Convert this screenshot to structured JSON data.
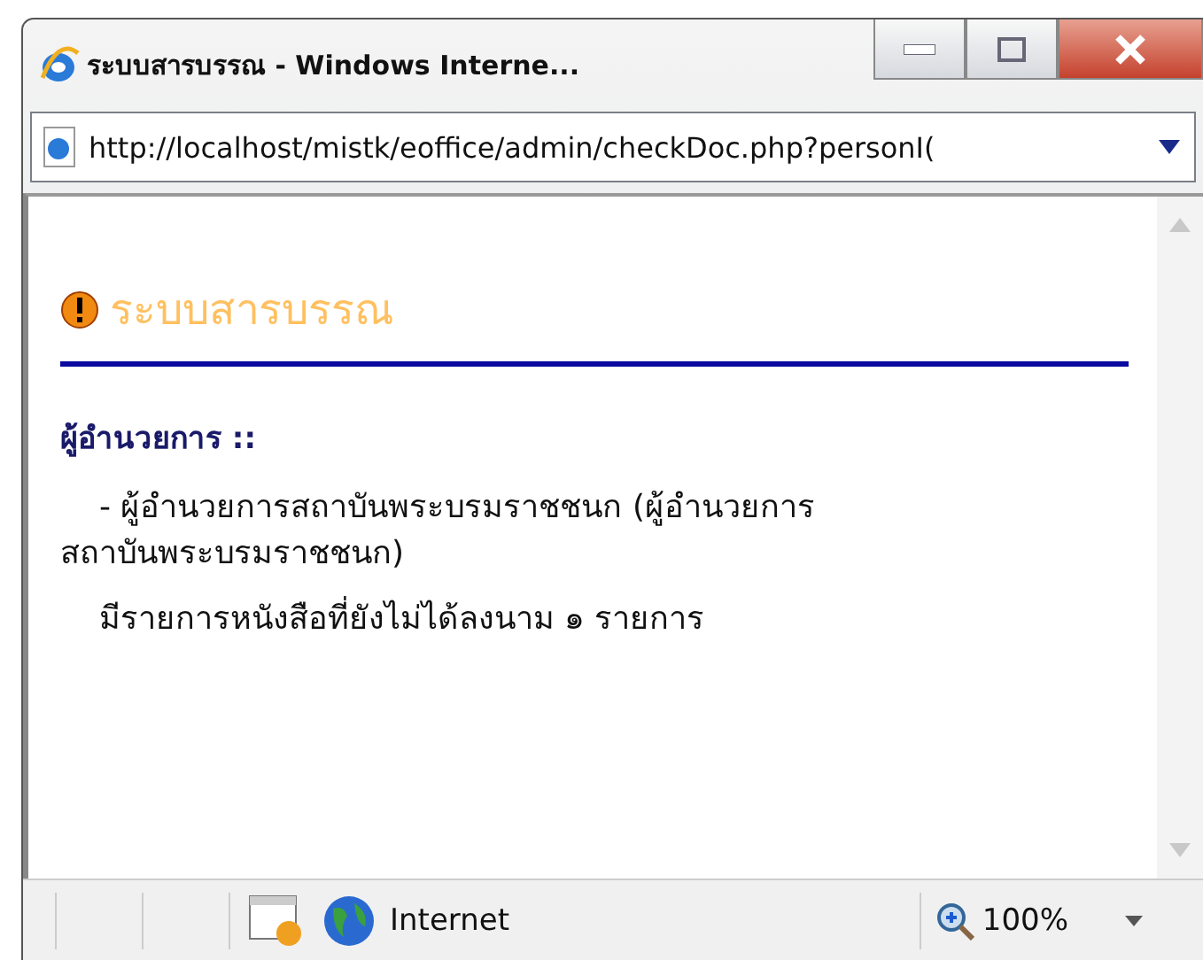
{
  "window": {
    "title": "ระบบสารบรรณ - Windows Interne..."
  },
  "address_bar": {
    "url": "http://localhost/mistk/eoffice/admin/checkDoc.php?personI("
  },
  "page": {
    "heading": "ระบบสารบรรณ",
    "section_label": "ผู้อำนวยการ ::",
    "position_line": "- ผู้อำนวยการสถาบันพระบรมราชชนก (ผู้อำนวยการ สถาบันพระบรมราชชนก)",
    "message": "มีรายการหนังสือที่ยังไม่ได้ลงนาม ๑ รายการ"
  },
  "status_bar": {
    "zone": "Internet",
    "zoom": "100%"
  }
}
